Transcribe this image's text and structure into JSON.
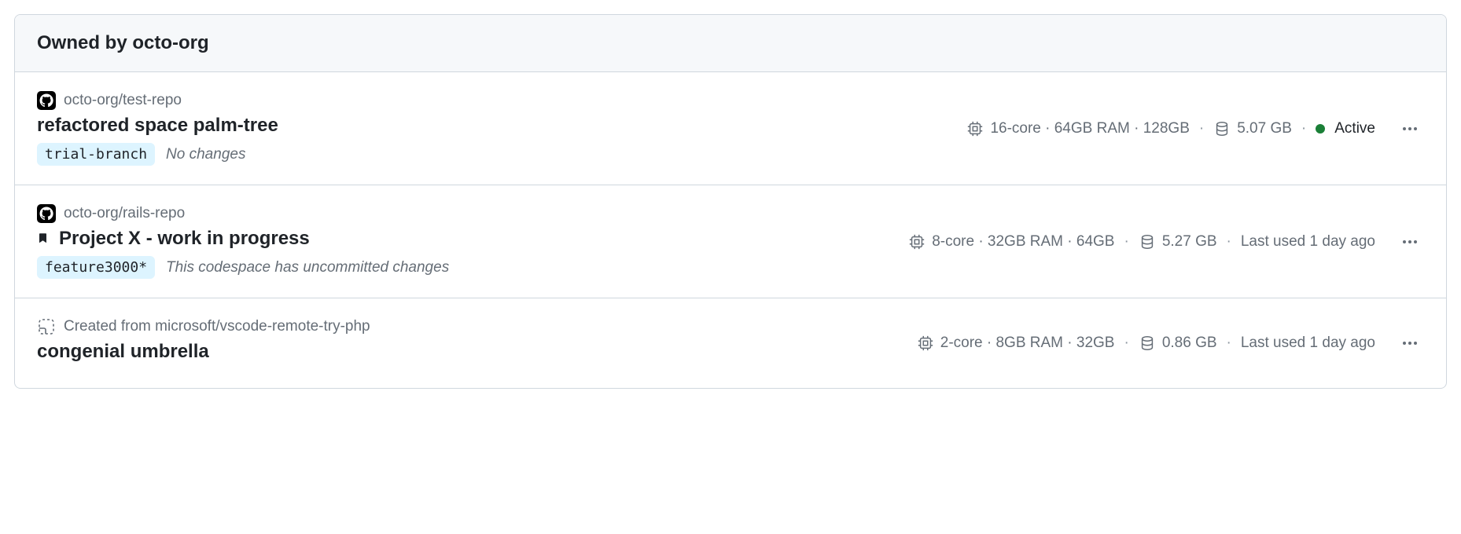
{
  "header": {
    "title": "Owned by octo-org"
  },
  "items": [
    {
      "repo": "octo-org/test-repo",
      "repo_icon": "github",
      "bookmarked": false,
      "name": "refactored space palm-tree",
      "branch": "trial-branch",
      "changes": "No changes",
      "specs": "16-core · 64GB RAM · 128GB",
      "disk": "5.07 GB",
      "status_type": "active",
      "status": "Active"
    },
    {
      "repo": "octo-org/rails-repo",
      "repo_icon": "github",
      "bookmarked": true,
      "name": "Project X - work in progress",
      "branch": "feature3000*",
      "changes": "This codespace has uncommitted changes",
      "specs": "8-core · 32GB RAM · 64GB",
      "disk": "5.27 GB",
      "status_type": "last_used",
      "status": "Last used 1 day ago"
    },
    {
      "repo": "Created from microsoft/vscode-remote-try-php",
      "repo_icon": "template",
      "bookmarked": false,
      "name": "congenial umbrella",
      "branch": null,
      "changes": null,
      "specs": "2-core · 8GB RAM · 32GB",
      "disk": "0.86 GB",
      "status_type": "last_used",
      "status": "Last used 1 day ago"
    }
  ],
  "separator": "·"
}
